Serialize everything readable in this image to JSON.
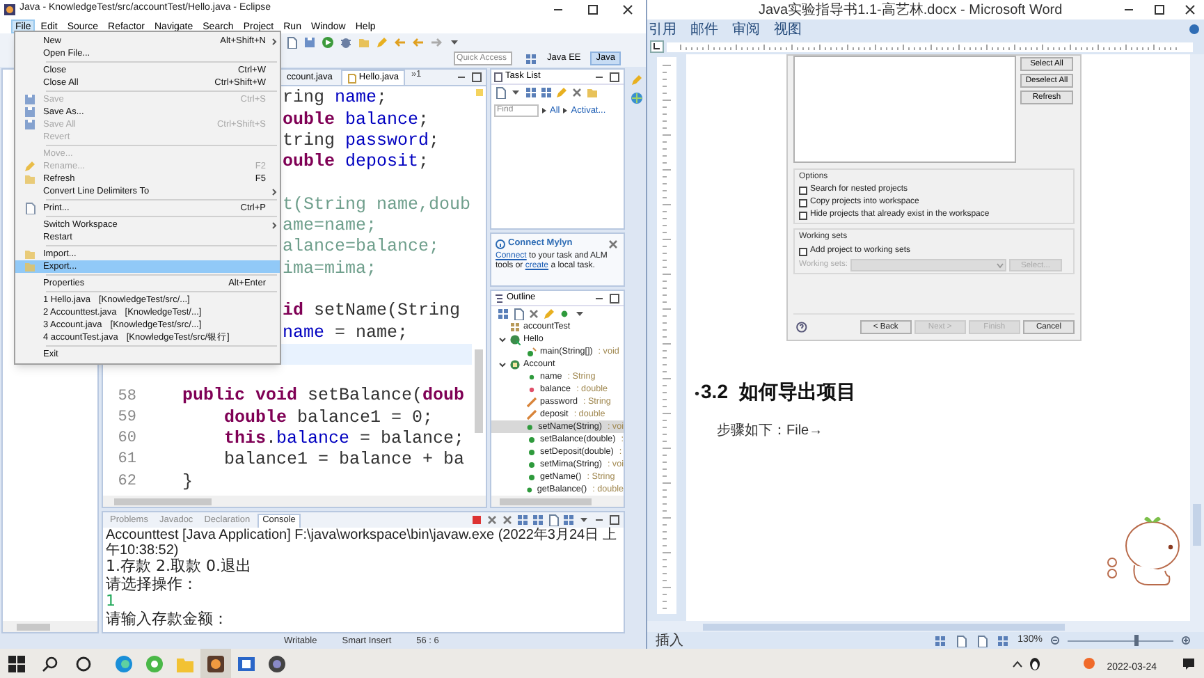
{
  "eclipse": {
    "title": "Java - KnowledgeTest/src/accountTest/Hello.java - Eclipse",
    "menus": [
      {
        "label": "File",
        "selected": true
      },
      {
        "label": "Edit",
        "selected": false
      },
      {
        "label": "Source",
        "selected": false
      },
      {
        "label": "Refactor",
        "selected": false
      },
      {
        "label": "Navigate",
        "selected": false
      },
      {
        "label": "Search",
        "selected": false
      },
      {
        "label": "Project",
        "selected": false
      },
      {
        "label": "Run",
        "selected": false
      },
      {
        "label": "Window",
        "selected": false
      },
      {
        "label": "Help",
        "selected": false
      }
    ],
    "quick_access": {
      "placeholder": "Quick Access"
    },
    "perspectives": [
      {
        "label": "Java EE",
        "selected": false
      },
      {
        "label": "Java",
        "selected": true
      }
    ],
    "file_menu": [
      {
        "kind": "item",
        "label": "New",
        "shortcut": "Alt+Shift+N",
        "submenu": true,
        "disabled": false,
        "selected": false
      },
      {
        "kind": "item",
        "label": "Open File...",
        "submenu": false,
        "disabled": false,
        "selected": false
      },
      {
        "kind": "separator"
      },
      {
        "kind": "item",
        "label": "Close",
        "shortcut": "Ctrl+W",
        "submenu": false,
        "disabled": false,
        "selected": false
      },
      {
        "kind": "item",
        "label": "Close All",
        "shortcut": "Ctrl+Shift+W",
        "submenu": false,
        "disabled": false,
        "selected": false
      },
      {
        "kind": "separator"
      },
      {
        "kind": "item",
        "label": "Save",
        "shortcut": "Ctrl+S",
        "submenu": false,
        "disabled": true,
        "selected": false
      },
      {
        "kind": "item",
        "label": "Save As...",
        "submenu": false,
        "disabled": false,
        "selected": false
      },
      {
        "kind": "item",
        "label": "Save All",
        "shortcut": "Ctrl+Shift+S",
        "submenu": false,
        "disabled": true,
        "selected": false
      },
      {
        "kind": "item",
        "label": "Revert",
        "submenu": false,
        "disabled": true,
        "selected": false
      },
      {
        "kind": "separator"
      },
      {
        "kind": "item",
        "label": "Move...",
        "submenu": false,
        "disabled": true,
        "selected": false
      },
      {
        "kind": "item",
        "label": "Rename...",
        "shortcut": "F2",
        "submenu": false,
        "disabled": true,
        "selected": false
      },
      {
        "kind": "item",
        "label": "Refresh",
        "shortcut": "F5",
        "submenu": false,
        "disabled": false,
        "selected": false
      },
      {
        "kind": "item",
        "label": "Convert Line Delimiters To",
        "submenu": true,
        "disabled": false,
        "selected": false
      },
      {
        "kind": "separator"
      },
      {
        "kind": "item",
        "label": "Print...",
        "shortcut": "Ctrl+P",
        "submenu": false,
        "disabled": false,
        "selected": false
      },
      {
        "kind": "separator"
      },
      {
        "kind": "item",
        "label": "Switch Workspace",
        "submenu": true,
        "disabled": false,
        "selected": false
      },
      {
        "kind": "item",
        "label": "Restart",
        "submenu": false,
        "disabled": false,
        "selected": false
      },
      {
        "kind": "separator"
      },
      {
        "kind": "item",
        "label": "Import...",
        "submenu": false,
        "disabled": false,
        "selected": false
      },
      {
        "kind": "item",
        "label": "Export...",
        "submenu": false,
        "disabled": false,
        "selected": true
      },
      {
        "kind": "separator"
      },
      {
        "kind": "item",
        "label": "Properties",
        "shortcut": "Alt+Enter",
        "submenu": false,
        "disabled": false,
        "selected": false
      },
      {
        "kind": "separator"
      },
      {
        "kind": "item",
        "label": "1 Hello.java",
        "detail": "[KnowledgeTest/src/...]",
        "submenu": false,
        "disabled": false,
        "selected": false
      },
      {
        "kind": "item",
        "label": "2 Accounttest.java",
        "detail": "[KnowledgeTest/...]",
        "submenu": false,
        "disabled": false,
        "selected": false
      },
      {
        "kind": "item",
        "label": "3 Account.java",
        "detail": "[KnowledgeTest/src/...]",
        "submenu": false,
        "disabled": false,
        "selected": false
      },
      {
        "kind": "item",
        "label": "4 accountTest.java",
        "detail": "[KnowledgeTest/src/银行]",
        "submenu": false,
        "disabled": false,
        "selected": false
      },
      {
        "kind": "separator"
      },
      {
        "kind": "item",
        "label": "Exit",
        "submenu": false,
        "disabled": false,
        "selected": false
      }
    ],
    "editor": {
      "tabs": [
        {
          "label": "ccount.java",
          "selected": false
        },
        {
          "label": "Hello.java",
          "selected": true
        }
      ],
      "overflow": "»1",
      "lines": [
        {
          "kind": "clipped",
          "current": false,
          "segments": [
            {
              "text": "ring ",
              "kind": "plain"
            },
            {
              "text": "name",
              "kind": "field"
            },
            {
              "text": ";",
              "kind": "plain"
            }
          ]
        },
        {
          "kind": "clipped",
          "current": false,
          "segments": [
            {
              "text": "ouble ",
              "kind": "keyword"
            },
            {
              "text": "balance",
              "kind": "field"
            },
            {
              "text": ";",
              "kind": "plain"
            }
          ]
        },
        {
          "kind": "clipped",
          "current": false,
          "segments": [
            {
              "text": "tring ",
              "kind": "plain"
            },
            {
              "text": "password",
              "kind": "field"
            },
            {
              "text": ";",
              "kind": "plain"
            }
          ]
        },
        {
          "kind": "clipped",
          "current": false,
          "segments": [
            {
              "text": "ouble ",
              "kind": "keyword"
            },
            {
              "text": "deposit",
              "kind": "field"
            },
            {
              "text": ";",
              "kind": "plain"
            }
          ]
        },
        {
          "kind": "blank",
          "current": false
        },
        {
          "kind": "clipped",
          "current": false,
          "segments": [
            {
              "text": "t(String name,doub",
              "kind": "faded"
            }
          ]
        },
        {
          "kind": "clipped",
          "current": false,
          "segments": [
            {
              "text": "ame=name;",
              "kind": "faded"
            }
          ]
        },
        {
          "kind": "clipped",
          "current": false,
          "segments": [
            {
              "text": "alance=balance;",
              "kind": "faded"
            }
          ]
        },
        {
          "kind": "clipped",
          "current": false,
          "segments": [
            {
              "text": "ima=mima;",
              "kind": "faded"
            }
          ]
        },
        {
          "kind": "blank",
          "current": false
        },
        {
          "kind": "clipped",
          "current": false,
          "segments": [
            {
              "text": "id ",
              "kind": "keyword"
            },
            {
              "text": "setName(String",
              "kind": "plain"
            }
          ]
        },
        {
          "kind": "clipped",
          "current": false,
          "segments": [
            {
              "text": "name",
              "kind": "field"
            },
            {
              "text": " = name;",
              "kind": "plain"
            }
          ]
        },
        {
          "kind": "blank",
          "current": true
        },
        {
          "kind": "blank",
          "current": false
        },
        {
          "kind": "full",
          "number": "58",
          "current": false,
          "segments": [
            {
              "text": "    public void ",
              "kind": "keyword"
            },
            {
              "text": "setBalance(",
              "kind": "plain"
            },
            {
              "text": "doub",
              "kind": "keyword"
            }
          ]
        },
        {
          "kind": "full",
          "number": "59",
          "current": false,
          "segments": [
            {
              "text": "        double ",
              "kind": "keyword"
            },
            {
              "text": "balance1 = 0;",
              "kind": "plain"
            }
          ]
        },
        {
          "kind": "full",
          "number": "60",
          "current": false,
          "segments": [
            {
              "text": "        this",
              "kind": "keyword"
            },
            {
              "text": ".",
              "kind": "plain"
            },
            {
              "text": "balance",
              "kind": "field"
            },
            {
              "text": " = balance;",
              "kind": "plain"
            }
          ]
        },
        {
          "kind": "full",
          "number": "61",
          "current": false,
          "segments": [
            {
              "text": "        balance1 = balance + ba",
              "kind": "plain"
            }
          ]
        },
        {
          "kind": "full",
          "number": "62",
          "current": false,
          "segments": [
            {
              "text": "    }",
              "kind": "plain"
            }
          ]
        }
      ]
    },
    "task_list": {
      "title": "Task List",
      "find": {
        "placeholder": "Find"
      },
      "filters": [
        "All",
        "Activat..."
      ]
    },
    "mylyn": {
      "title": "Connect Mylyn",
      "parts": [
        {
          "text": "Connect",
          "kind": "link"
        },
        {
          "text": " to your task and ALM tools or ",
          "kind": "text"
        },
        {
          "text": "create",
          "kind": "link"
        },
        {
          "text": " a local task.",
          "kind": "text"
        }
      ]
    },
    "outline": {
      "title": "Outline",
      "tree": [
        {
          "label": "accountTest",
          "kind": "package",
          "selected": false
        },
        {
          "label": "Hello",
          "kind": "class-main",
          "selected": false,
          "expanded": true,
          "children": [
            {
              "label": "main(String[])",
              "type": ": void",
              "kind": "method-static",
              "selected": false
            }
          ]
        },
        {
          "label": "Account",
          "kind": "class",
          "selected": false,
          "expanded": true,
          "children": [
            {
              "label": "name",
              "type": ": String",
              "kind": "field-public",
              "selected": false
            },
            {
              "label": "balance",
              "type": ": double",
              "kind": "field-private",
              "selected": false
            },
            {
              "label": "password",
              "type": ": String",
              "kind": "field-protected",
              "selected": false
            },
            {
              "label": "deposit",
              "type": ": double",
              "kind": "field-protected",
              "selected": false
            },
            {
              "label": "setName(String)",
              "type": ": voi",
              "kind": "method",
              "selected": true
            },
            {
              "label": "setBalance(double)",
              "type": ":",
              "kind": "method",
              "selected": false
            },
            {
              "label": "setDeposit(double)",
              "type": ":",
              "kind": "method",
              "selected": false
            },
            {
              "label": "setMima(String)",
              "type": ": voi",
              "kind": "method",
              "selected": false
            },
            {
              "label": "getName()",
              "type": ": String",
              "kind": "method",
              "selected": false
            },
            {
              "label": "getBalance()",
              "type": ": double",
              "kind": "method",
              "selected": false
            }
          ]
        }
      ]
    },
    "console": {
      "tabs": [
        {
          "label": "Problems",
          "selected": false
        },
        {
          "label": "Javadoc",
          "selected": false
        },
        {
          "label": "Declaration",
          "selected": false
        },
        {
          "label": "Console",
          "selected": true
        }
      ],
      "header": "Accounttest [Java Application] F:\\java\\workspace\\bin\\javaw.exe (2022年3月24日 上午10:38:52)",
      "output": [
        {
          "text": "1.存款 2.取款 0.退出",
          "kind": "output"
        },
        {
          "text": "请选择操作：",
          "kind": "output"
        },
        {
          "text": "1",
          "kind": "input"
        },
        {
          "text": "请输入存款金额：",
          "kind": "output"
        }
      ]
    },
    "status_bar": [
      "Writable",
      "Smart Insert",
      "56 : 6"
    ]
  },
  "word": {
    "title": "Java实验指导书1.1-高艺林.docx - Microsoft Word",
    "ribbon_tabs": [
      "引用",
      "邮件",
      "审阅",
      "视图"
    ],
    "dialog": {
      "side_buttons": [
        "Select All",
        "Deselect All",
        "Refresh"
      ],
      "options": {
        "title": "Options",
        "checks": [
          {
            "label": "Search for nested projects",
            "checked": false
          },
          {
            "label": "Copy projects into workspace",
            "checked": false
          },
          {
            "label": "Hide projects that already exist in the workspace",
            "checked": false
          }
        ]
      },
      "working_sets": {
        "title": "Working sets",
        "check": {
          "label": "Add project to working sets",
          "checked": false
        },
        "field_label": "Working sets:",
        "select_button": "Select...",
        "disabled": true
      },
      "footer_buttons": [
        {
          "label": "< Back",
          "disabled": false
        },
        {
          "label": "Next >",
          "disabled": true
        },
        {
          "label": "Finish",
          "disabled": true
        },
        {
          "label": "Cancel",
          "disabled": false
        }
      ]
    },
    "heading": {
      "marker": "•",
      "text": "3.2  如何导出项目"
    },
    "paragraph": "步骤如下：File→",
    "status": {
      "mode": "插入",
      "zoom": "130%",
      "level": 0.65
    }
  },
  "taskbar": {
    "date": "2022-03-24"
  }
}
